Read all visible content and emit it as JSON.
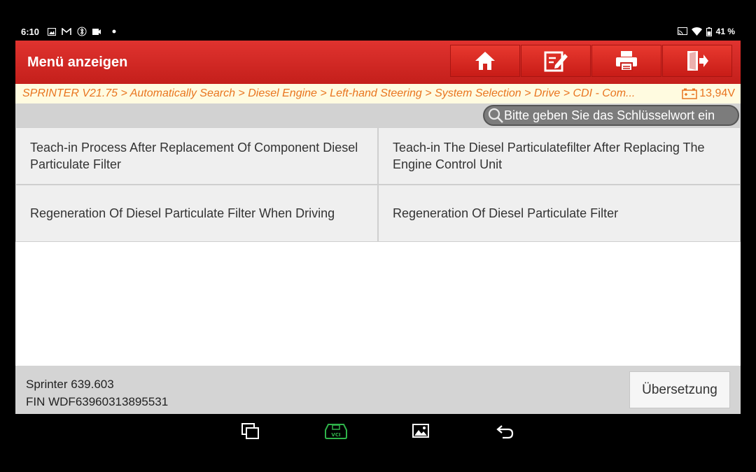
{
  "status_bar": {
    "time": "6:10",
    "battery": "41 %",
    "left_icons": [
      "image-icon",
      "mail-icon",
      "bluetooth-icon",
      "video-icon",
      "dot-icon"
    ],
    "right_icons": [
      "cast-icon",
      "wifi-icon",
      "battery-icon"
    ]
  },
  "header": {
    "title": "Menü anzeigen",
    "buttons": [
      "home-icon",
      "edit-icon",
      "print-icon",
      "exit-icon"
    ]
  },
  "breadcrumb": {
    "path": "SPRINTER V21.75 > Automatically Search > Diesel Engine > Left-hand Steering > System Selection > Drive > CDI -  Com...",
    "voltage": "13,94V"
  },
  "search": {
    "placeholder": "Bitte geben Sie das Schlüsselwort ein"
  },
  "functions": [
    {
      "label": "Teach-in Process After Replacement Of Component Diesel Particulate Filter"
    },
    {
      "label": "Teach-in The Diesel Particulatefilter After Replacing The Engine Control Unit"
    },
    {
      "label": "Regeneration Of Diesel Particulate Filter When Driving"
    },
    {
      "label": "Regeneration Of Diesel Particulate Filter"
    }
  ],
  "footer": {
    "model": "Sprinter 639.603",
    "vin": "FIN WDF63960313895531",
    "translate_label": "Übersetzung"
  },
  "colors": {
    "header_red": "#d42a25",
    "breadcrumb_text": "#e9751f",
    "vci_green": "#2fb34a"
  }
}
